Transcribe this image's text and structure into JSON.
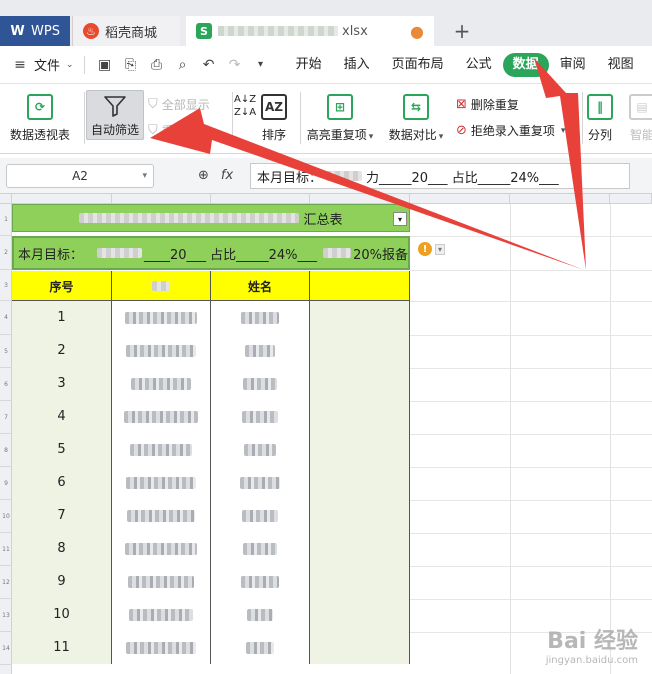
{
  "tabs": {
    "wps": "WPS",
    "daoke": "稻壳商城",
    "file_suffix": "xlsx"
  },
  "menu": {
    "file": "文件",
    "items": [
      "开始",
      "插入",
      "页面布局",
      "公式",
      "数据",
      "审阅",
      "视图"
    ],
    "active": "数据"
  },
  "ribbon": {
    "pivot": "数据透视表",
    "autofilter": "自动筛选",
    "show_all": "全部显示",
    "reapply": "重新应用",
    "sort": "排序",
    "highlight_dup": "高亮重复项",
    "compare": "数据对比",
    "remove_dup": "删除重复",
    "reject_dup": "拒绝录入重复项",
    "split": "分列",
    "smart": "智能"
  },
  "formula_bar": {
    "cell_ref": "A2",
    "fx": "fx",
    "content_prefix": "本月目标：",
    "content_mid": "力_____20___ 占比_____24%___"
  },
  "sheet": {
    "title_suffix": "汇总表",
    "target_prefix": "本月目标：",
    "target_mid": "____20___ 占比_____24%___",
    "target_suffix": "20%报备",
    "headers": [
      "序号",
      "",
      "姓名",
      ""
    ],
    "rows": [
      "1",
      "2",
      "3",
      "4",
      "5",
      "6",
      "7",
      "8",
      "9",
      "10",
      "11"
    ],
    "row_numbers": [
      "1",
      "2",
      "3",
      "4",
      "5",
      "6",
      "7",
      "8",
      "9",
      "10",
      "11",
      "12",
      "13",
      "14"
    ]
  },
  "watermark": {
    "main": "Bai 经验",
    "sub": "jingyan.baidu.com"
  },
  "colors": {
    "accent_green": "#2aa55a",
    "title_green": "#8fd05a",
    "header_yellow": "#ffff00",
    "arrow_red": "#e8413a",
    "wps_blue": "#2f5597"
  }
}
